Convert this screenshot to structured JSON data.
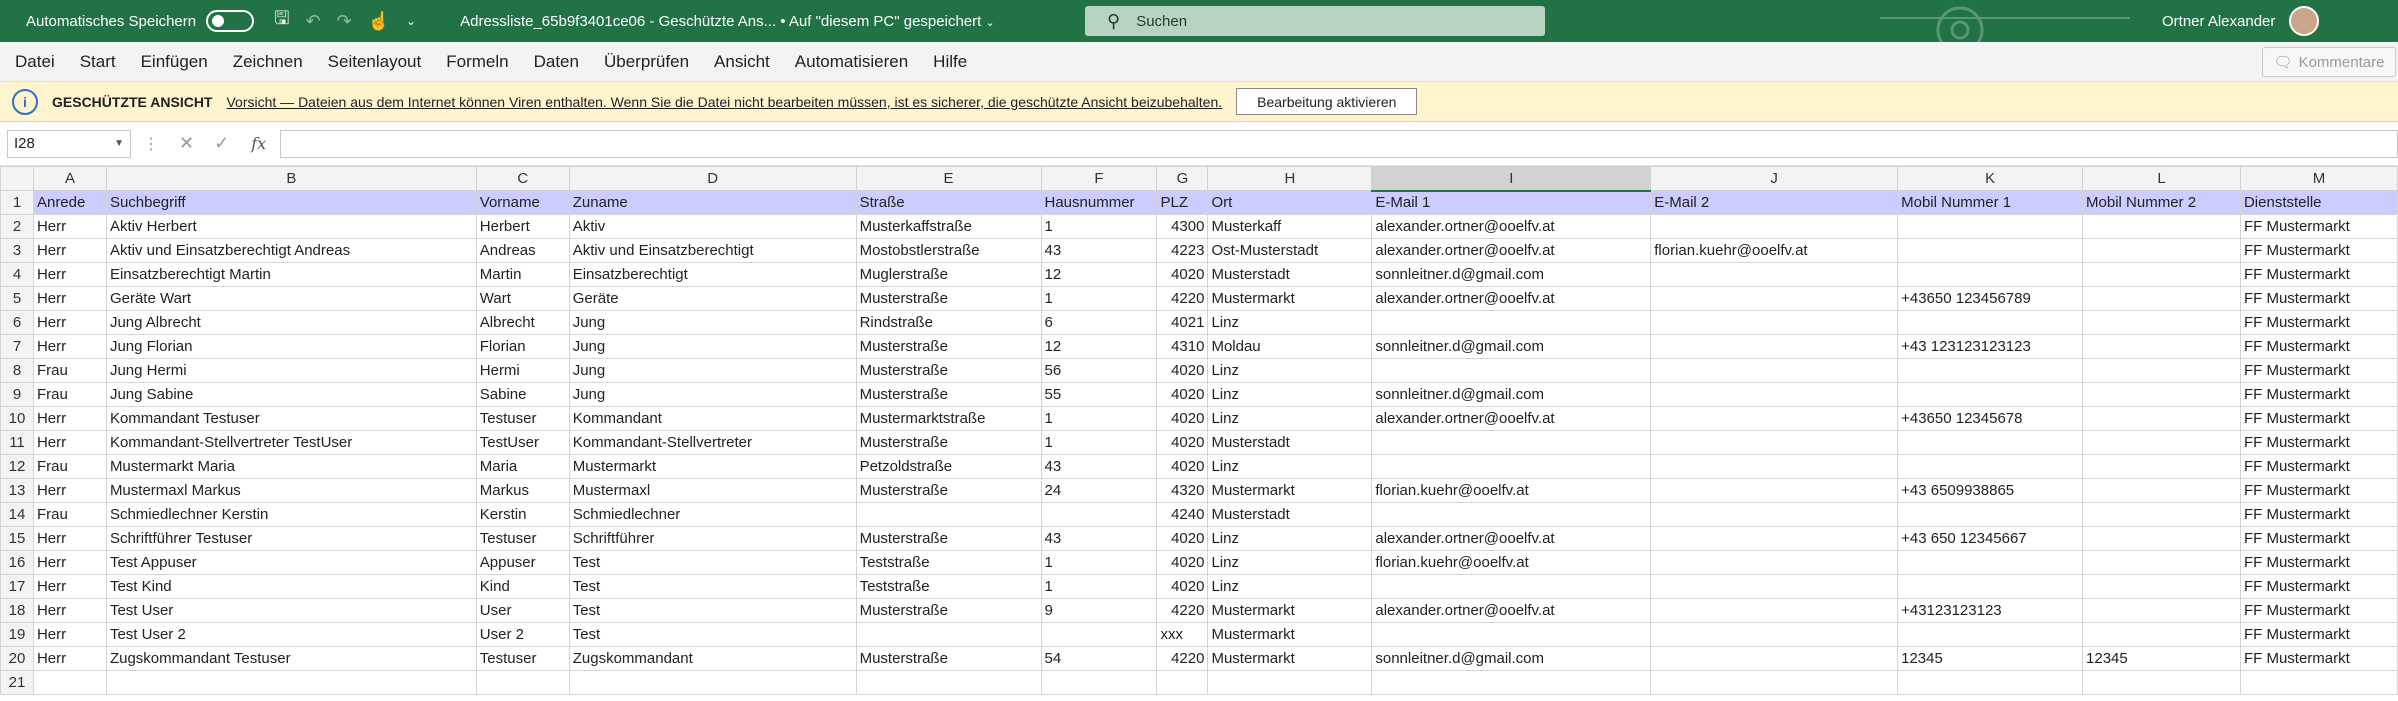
{
  "titlebar": {
    "autosave_label": "Automatisches Speichern",
    "doc_title": "Adressliste_65b9f3401ce06  -  Geschützte Ans...  •  Auf \"diesem PC\" gespeichert",
    "search_placeholder": "Suchen",
    "user_name": "Ortner Alexander"
  },
  "menu": [
    "Datei",
    "Start",
    "Einfügen",
    "Zeichnen",
    "Seitenlayout",
    "Formeln",
    "Daten",
    "Überprüfen",
    "Ansicht",
    "Automatisieren",
    "Hilfe"
  ],
  "comments_label": "Kommentare",
  "protected_view": {
    "title": "GESCHÜTZTE ANSICHT",
    "message": "Vorsicht — Dateien aus dem Internet können Viren enthalten. Wenn Sie die Datei nicht bearbeiten müssen, ist es sicherer, die geschützte Ansicht beizubehalten.",
    "button": "Bearbeitung aktivieren"
  },
  "formula_bar": {
    "name_box": "I28",
    "fx": "fx"
  },
  "sheet": {
    "columns": [
      "A",
      "B",
      "C",
      "D",
      "E",
      "F",
      "G",
      "H",
      "I",
      "J",
      "K",
      "L",
      "M"
    ],
    "selected_column": "I",
    "rows": [
      [
        "Anrede",
        "Suchbegriff",
        "Vorname",
        "Zuname",
        "Straße",
        "Hausnummer",
        "PLZ",
        "Ort",
        "E-Mail 1",
        "E-Mail 2",
        "Mobil Nummer 1",
        "Mobil Nummer 2",
        "Dienststelle"
      ],
      [
        "Herr",
        "Aktiv Herbert",
        "Herbert",
        "Aktiv",
        "Musterkaffstraße",
        "1",
        "4300",
        "Musterkaff",
        "alexander.ortner@ooelfv.at",
        "",
        "",
        "",
        "FF Mustermarkt"
      ],
      [
        "Herr",
        "Aktiv und Einsatzberechtigt Andreas",
        "Andreas",
        "Aktiv und Einsatzberechtigt",
        "Mostobstlerstraße",
        "43",
        "4223",
        "Ost-Musterstadt",
        "alexander.ortner@ooelfv.at",
        "florian.kuehr@ooelfv.at",
        "",
        "",
        "FF Mustermarkt"
      ],
      [
        "Herr",
        "Einsatzberechtigt Martin",
        "Martin",
        "Einsatzberechtigt",
        "Muglerstraße",
        "12",
        "4020",
        "Musterstadt",
        "sonnleitner.d@gmail.com",
        "",
        "",
        "",
        "FF Mustermarkt"
      ],
      [
        "Herr",
        "Geräte Wart",
        "Wart",
        "Geräte",
        "Musterstraße",
        "1",
        "4220",
        "Mustermarkt",
        "alexander.ortner@ooelfv.at",
        "",
        "+43650 123456789",
        "",
        "FF Mustermarkt"
      ],
      [
        "Herr",
        "Jung Albrecht",
        "Albrecht",
        "Jung",
        "Rindstraße",
        "6",
        "4021",
        "Linz",
        "",
        "",
        "",
        "",
        "FF Mustermarkt"
      ],
      [
        "Herr",
        "Jung Florian",
        "Florian",
        "Jung",
        "Musterstraße",
        "12",
        "4310",
        "Moldau",
        "sonnleitner.d@gmail.com",
        "",
        "+43 123123123123",
        "",
        "FF Mustermarkt"
      ],
      [
        "Frau",
        "Jung Hermi",
        "Hermi",
        "Jung",
        "Musterstraße",
        "56",
        "4020",
        "Linz",
        "",
        "",
        "",
        "",
        "FF Mustermarkt"
      ],
      [
        "Frau",
        "Jung Sabine",
        "Sabine",
        "Jung",
        "Musterstraße",
        "55",
        "4020",
        "Linz",
        "sonnleitner.d@gmail.com",
        "",
        "",
        "",
        "FF Mustermarkt"
      ],
      [
        "Herr",
        "Kommandant Testuser",
        "Testuser",
        "Kommandant",
        "Mustermarktstraße",
        "1",
        "4020",
        "Linz",
        "alexander.ortner@ooelfv.at",
        "",
        "+43650 12345678",
        "",
        "FF Mustermarkt"
      ],
      [
        "Herr",
        "Kommandant-Stellvertreter TestUser",
        "TestUser",
        "Kommandant-Stellvertreter",
        "Musterstraße",
        "1",
        "4020",
        "Musterstadt",
        "",
        "",
        "",
        "",
        "FF Mustermarkt"
      ],
      [
        "Frau",
        "Mustermarkt Maria",
        "Maria",
        "Mustermarkt",
        "Petzoldstraße",
        "43",
        "4020",
        "Linz",
        "",
        "",
        "",
        "",
        "FF Mustermarkt"
      ],
      [
        "Herr",
        "Mustermaxl Markus",
        "Markus",
        "Mustermaxl",
        "Musterstraße",
        "24",
        "4320",
        "Mustermarkt",
        "florian.kuehr@ooelfv.at",
        "",
        "+43 6509938865",
        "",
        "FF Mustermarkt"
      ],
      [
        "Frau",
        "Schmiedlechner Kerstin",
        "Kerstin",
        "Schmiedlechner",
        "",
        "",
        "4240",
        "Musterstadt",
        "",
        "",
        "",
        "",
        "FF Mustermarkt"
      ],
      [
        "Herr",
        "Schriftführer Testuser",
        "Testuser",
        "Schriftführer",
        "Musterstraße",
        "43",
        "4020",
        "Linz",
        "alexander.ortner@ooelfv.at",
        "",
        "+43 650 12345667",
        "",
        "FF Mustermarkt"
      ],
      [
        "Herr",
        "Test Appuser",
        "Appuser",
        "Test",
        "Teststraße",
        "1",
        "4020",
        "Linz",
        "florian.kuehr@ooelfv.at",
        "",
        "",
        "",
        "FF Mustermarkt"
      ],
      [
        "Herr",
        "Test Kind",
        "Kind",
        "Test",
        "Teststraße",
        "1",
        "4020",
        "Linz",
        "",
        "",
        "",
        "",
        "FF Mustermarkt"
      ],
      [
        "Herr",
        "Test User",
        "User",
        "Test",
        "Musterstraße",
        "9",
        "4220",
        "Mustermarkt",
        "alexander.ortner@ooelfv.at",
        "",
        "+43123123123",
        "",
        "FF Mustermarkt"
      ],
      [
        "Herr",
        "Test User 2",
        "User 2",
        "Test",
        "",
        "",
        "xxx",
        "Mustermarkt",
        "",
        "",
        "",
        "",
        "FF Mustermarkt"
      ],
      [
        "Herr",
        "Zugskommandant Testuser",
        "Testuser",
        "Zugskommandant",
        "Musterstraße",
        "54",
        "4220",
        "Mustermarkt",
        "sonnleitner.d@gmail.com",
        "",
        "12345",
        "12345",
        "FF Mustermarkt"
      ],
      [
        "",
        "",
        "",
        "",
        "",
        "",
        "",
        "",
        "",
        "",
        "",
        "",
        ""
      ]
    ]
  },
  "colors": {
    "title_green": "#217346",
    "header_row_fill": "#ccccff",
    "protected_yellow": "#fff4ce"
  }
}
